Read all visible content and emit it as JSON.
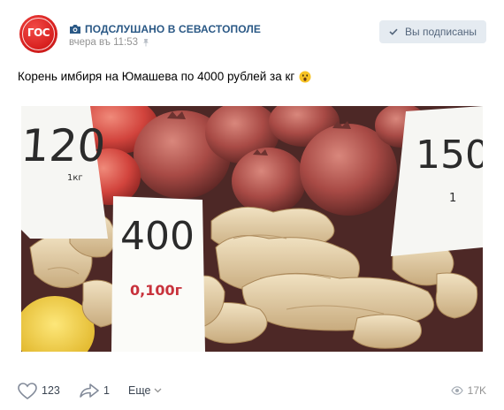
{
  "post": {
    "group_name": "ПОДСЛУШАНО В СЕВАСТОПОЛЕ",
    "avatar_text": "ГОС",
    "timestamp": "вчера въ 11:53",
    "subscribe_label": "Вы подписаны",
    "text": "Корень имбиря на Юмашева по 4000 рублей за кг"
  },
  "photo": {
    "price_left": "120",
    "unit_left": "1кг",
    "price_center": "400",
    "weight_center": "0,100г",
    "price_right": "150",
    "unit_right": "1"
  },
  "actions": {
    "likes": "123",
    "shares": "1",
    "more_label": "Еще",
    "views": "17K"
  },
  "colors": {
    "link": "#2a5885",
    "button_bg": "#e5ebf1",
    "avatar": "#d8201f"
  }
}
